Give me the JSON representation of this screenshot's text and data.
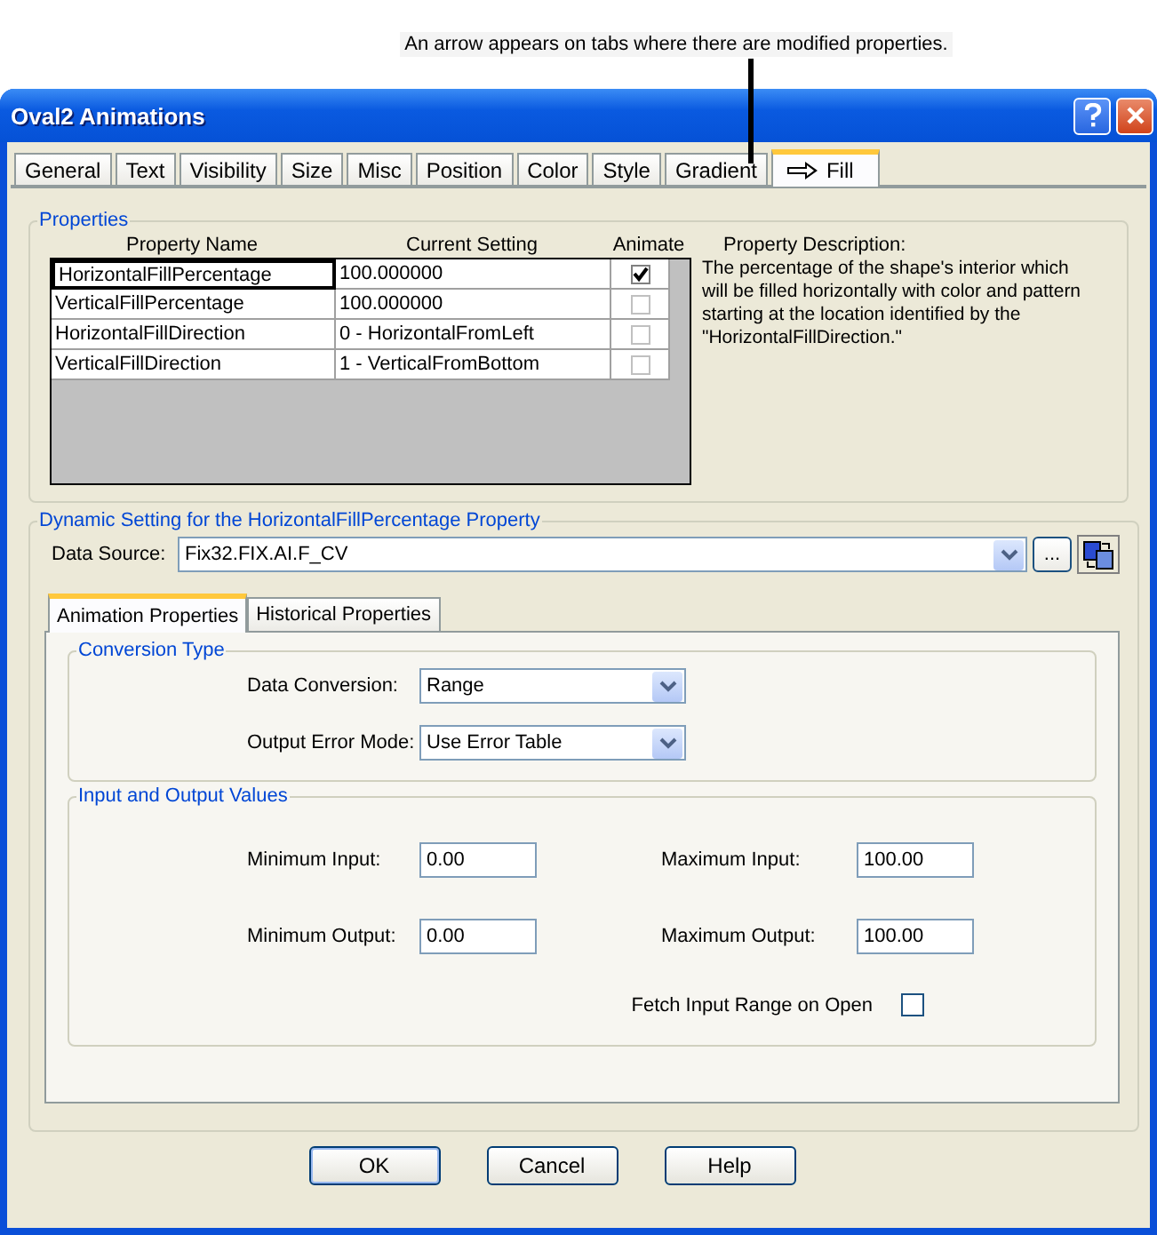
{
  "annotation": {
    "text": "An arrow appears on tabs where there are modified properties."
  },
  "window": {
    "title": "Oval2 Animations"
  },
  "tabs": [
    {
      "label": "General",
      "selected": false,
      "modified": false
    },
    {
      "label": "Text",
      "selected": false,
      "modified": false
    },
    {
      "label": "Visibility",
      "selected": false,
      "modified": false
    },
    {
      "label": "Size",
      "selected": false,
      "modified": false
    },
    {
      "label": "Misc",
      "selected": false,
      "modified": false
    },
    {
      "label": "Position",
      "selected": false,
      "modified": false
    },
    {
      "label": "Color",
      "selected": false,
      "modified": false
    },
    {
      "label": "Style",
      "selected": false,
      "modified": false
    },
    {
      "label": "Gradient",
      "selected": false,
      "modified": false
    },
    {
      "label": "Fill",
      "selected": true,
      "modified": true
    }
  ],
  "properties": {
    "title": "Properties",
    "columns": [
      "Property Name",
      "Current Setting",
      "Animate"
    ],
    "rows": [
      {
        "name": "HorizontalFillPercentage",
        "value": "100.000000",
        "animate": true,
        "selected": true
      },
      {
        "name": "VerticalFillPercentage",
        "value": "100.000000",
        "animate": false,
        "selected": false
      },
      {
        "name": "HorizontalFillDirection",
        "value": "0 - HorizontalFromLeft",
        "animate": false,
        "selected": false
      },
      {
        "name": "VerticalFillDirection",
        "value": "1 - VerticalFromBottom",
        "animate": false,
        "selected": false
      }
    ],
    "description_label": "Property Description:",
    "description": "The percentage of the shape's interior which will be filled horizontally with color and pattern starting at the location identified by the \"HorizontalFillDirection.\""
  },
  "dynamic": {
    "title": "Dynamic Setting for the HorizontalFillPercentage Property",
    "data_source": {
      "label": "Data Source:",
      "value": "Fix32.FIX.AI.F_CV"
    },
    "browse_button": "...",
    "tabs": [
      {
        "label": "Animation Properties",
        "selected": true
      },
      {
        "label": "Historical Properties",
        "selected": false
      }
    ],
    "conversion": {
      "title": "Conversion Type",
      "fields": [
        {
          "label": "Data Conversion:",
          "value": "Range"
        },
        {
          "label": "Output Error Mode:",
          "value": "Use Error Table"
        }
      ]
    },
    "values": {
      "title": "Input and Output Values",
      "fields": [
        {
          "label": "Minimum Input:",
          "value": "0.00"
        },
        {
          "label": "Maximum Input:",
          "value": "100.00"
        },
        {
          "label": "Minimum Output:",
          "value": "0.00"
        },
        {
          "label": "Maximum Output:",
          "value": "100.00"
        }
      ],
      "fetch": {
        "label": "Fetch Input Range on Open",
        "checked": false
      }
    }
  },
  "buttons": [
    {
      "label": "OK",
      "default": true
    },
    {
      "label": "Cancel",
      "default": false
    },
    {
      "label": "Help",
      "default": false
    }
  ]
}
